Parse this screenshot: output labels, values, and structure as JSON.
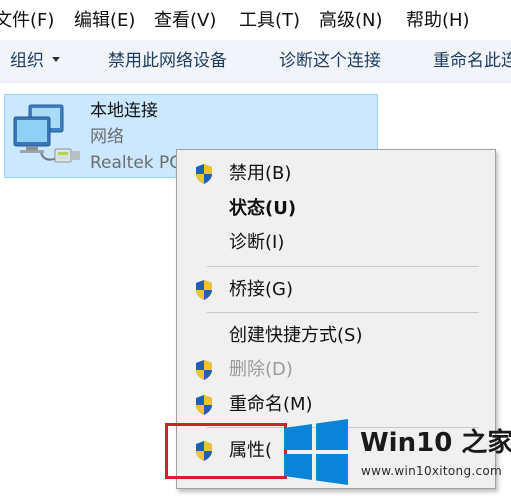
{
  "menubar": {
    "items": [
      "文件(F)",
      "编辑(E)",
      "查看(V)",
      "工具(T)",
      "高级(N)",
      "帮助(H)"
    ]
  },
  "toolbar": {
    "organize_label": "组织",
    "disable_label": "禁用此网络设备",
    "diagnose_label": "诊断这个连接",
    "rename_label": "重命名此连"
  },
  "network_item": {
    "name": "本地连接",
    "status": "网络",
    "device": "Realtek PC",
    "icon": "network-adapter-icon"
  },
  "context_menu": {
    "items": [
      {
        "label": "禁用(B)",
        "shield": true,
        "bold": false,
        "disabled": false
      },
      {
        "label": "状态(U)",
        "shield": false,
        "bold": true,
        "disabled": false
      },
      {
        "label": "诊断(I)",
        "shield": false,
        "bold": false,
        "disabled": false
      },
      {
        "label": "桥接(G)",
        "shield": true,
        "bold": false,
        "disabled": false
      },
      {
        "label": "创建快捷方式(S)",
        "shield": false,
        "bold": false,
        "disabled": false
      },
      {
        "label": "删除(D)",
        "shield": true,
        "bold": false,
        "disabled": true
      },
      {
        "label": "重命名(M)",
        "shield": true,
        "bold": false,
        "disabled": false
      },
      {
        "label": "属性(",
        "shield": true,
        "bold": false,
        "disabled": false
      }
    ]
  },
  "colors": {
    "selection_bg": "#cce8ff",
    "menu_bg": "#f0f0f0",
    "highlight_border": "#d4202a",
    "windows_blue": "#0a84d8"
  },
  "watermark": {
    "brand": "Win10 之家",
    "site": "www.win10xitong.com"
  }
}
